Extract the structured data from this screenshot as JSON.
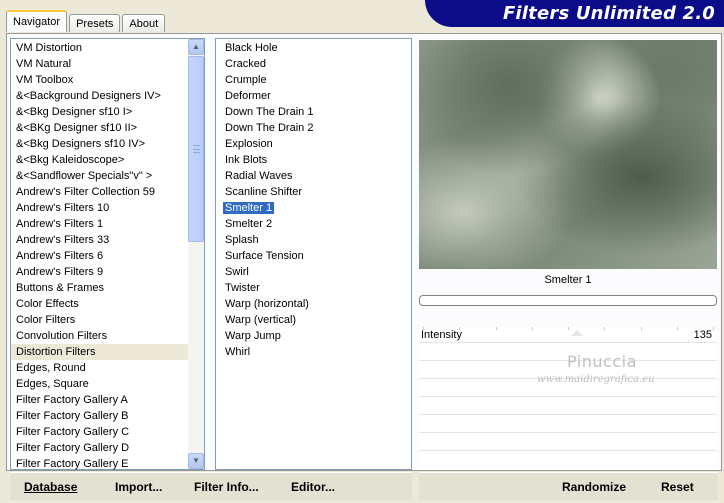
{
  "tabs": [
    {
      "label": "Navigator"
    },
    {
      "label": "Presets"
    },
    {
      "label": "About"
    }
  ],
  "banner": {
    "title": "Filters Unlimited 2.0",
    "color": "#0c0c88"
  },
  "categories": [
    "VM Distortion",
    "VM Natural",
    "VM Toolbox",
    "&<Background Designers IV>",
    "&<Bkg Designer sf10 I>",
    "&<BKg Designer sf10 II>",
    "&<Bkg Designers sf10 IV>",
    "&<Bkg Kaleidoscope>",
    "&<Sandflower Specials\"v\" >",
    "Andrew's Filter Collection 59",
    "Andrew's Filters 10",
    "Andrew's Filters 1",
    "Andrew's Filters 33",
    "Andrew's Filters 6",
    "Andrew's Filters 9",
    "Buttons & Frames",
    "Color Effects",
    "Color Filters",
    "Convolution Filters",
    "Distortion Filters",
    "Edges, Round",
    "Edges, Square",
    "Filter Factory Gallery A",
    "Filter Factory Gallery B",
    "Filter Factory Gallery C",
    "Filter Factory Gallery D",
    "Filter Factory Gallery E"
  ],
  "selected_category": "Distortion Filters",
  "filters": [
    "Black Hole",
    "Cracked",
    "Crumple",
    "Deformer",
    "Down The Drain 1",
    "Down The Drain 2",
    "Explosion",
    "Ink Blots",
    "Radial Waves",
    "Scanline Shifter",
    "Smelter 1",
    "Smelter 2",
    "Splash",
    "Surface Tension",
    "Swirl",
    "Twister",
    "Warp (horizontal)",
    "Warp (vertical)",
    "Warp Jump",
    "Whirl"
  ],
  "selected_filter": "Smelter 1",
  "preview": {
    "caption": "Smelter 1"
  },
  "params": [
    {
      "label": "Intensity",
      "value": "135",
      "level": 0.53
    }
  ],
  "watermark": {
    "line1": "Pinuccia",
    "line2": "www.maidiregrafica.eu"
  },
  "buttons": {
    "database": "Database",
    "import": "Import...",
    "filter_info": "Filter Info...",
    "editor": "Editor...",
    "randomize": "Randomize",
    "reset": "Reset"
  }
}
